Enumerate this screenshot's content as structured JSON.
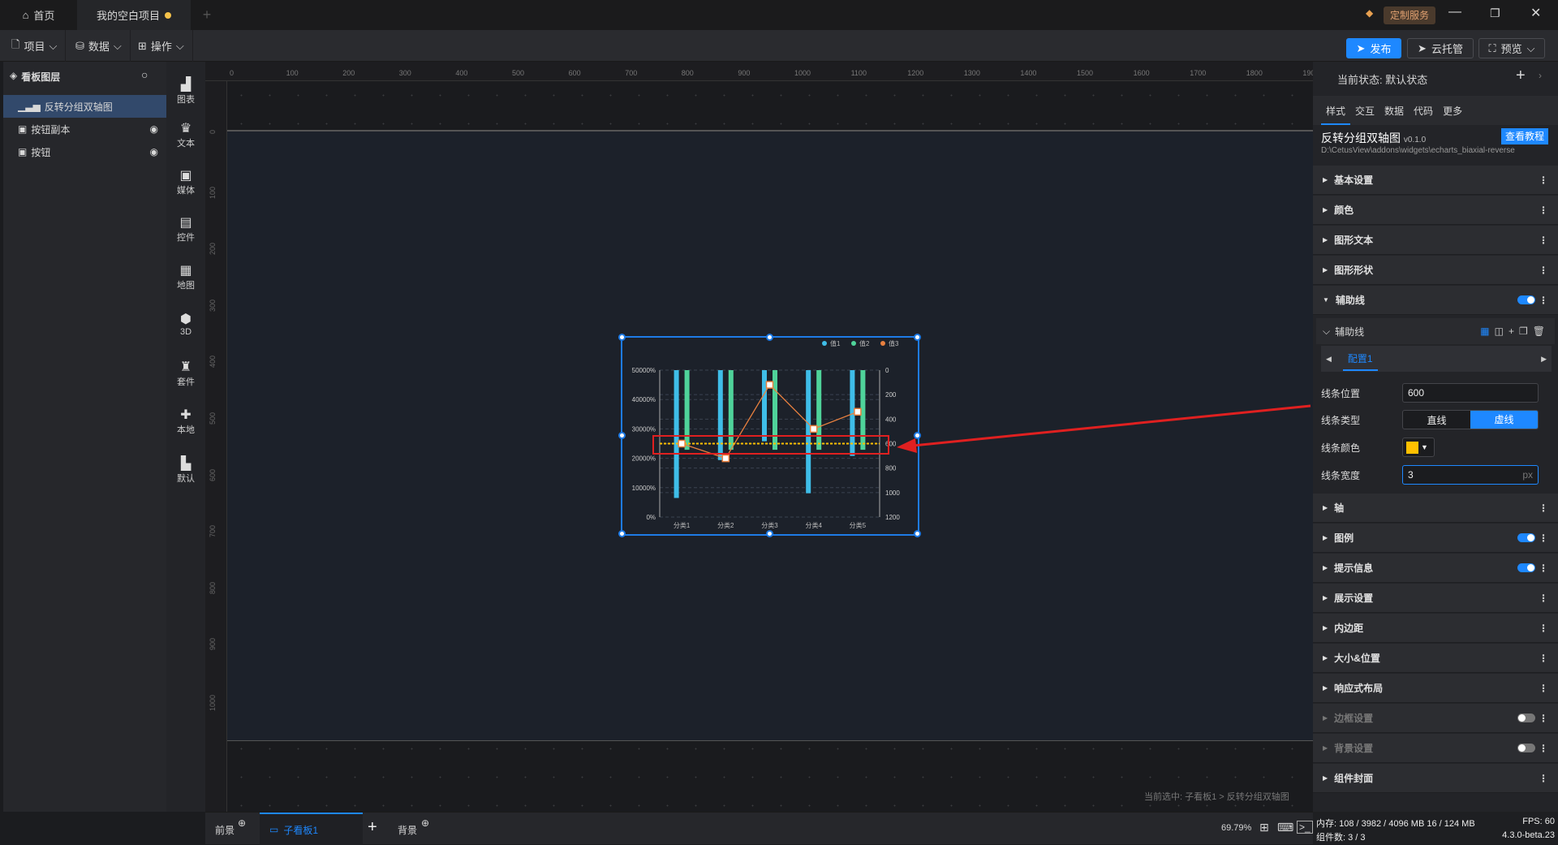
{
  "titlebar": {
    "home_tab": "首页",
    "project_tab": "我的空白项目",
    "custom_service": "定制服务"
  },
  "toolbar": {
    "project": "项目",
    "data": "数据",
    "operate": "操作",
    "publish": "发布",
    "cloud": "云托管",
    "preview": "预览"
  },
  "layers": {
    "title": "看板图层",
    "items": [
      {
        "label": "反转分组双轴图"
      },
      {
        "label": "按钮副本"
      },
      {
        "label": "按钮"
      }
    ]
  },
  "components": [
    {
      "label": "图表"
    },
    {
      "label": "文本"
    },
    {
      "label": "媒体"
    },
    {
      "label": "控件"
    },
    {
      "label": "地图"
    },
    {
      "label": "3D"
    },
    {
      "label": "套件"
    },
    {
      "label": "本地"
    },
    {
      "label": "默认"
    }
  ],
  "ruler": {
    "top": [
      "0",
      "100",
      "200",
      "300",
      "400",
      "500",
      "600",
      "700",
      "800",
      "900",
      "1000",
      "1100",
      "1200",
      "1300",
      "1400",
      "1500",
      "1600",
      "1700",
      "1800",
      "1900"
    ],
    "left": [
      "0",
      "100",
      "200",
      "300",
      "400",
      "500",
      "600",
      "700",
      "800",
      "900",
      "1000"
    ]
  },
  "breadcrumb": "当前选中: 子看板1 > 反转分组双轴图",
  "bottom_tabs": {
    "foreground": "前景",
    "subboard": "子看板1",
    "background": "背景"
  },
  "panel": {
    "state": "当前状态:  默认状态",
    "tabs": [
      "样式",
      "交互",
      "数据",
      "代码",
      "更多"
    ],
    "widget_name": "反转分组双轴图",
    "version": "v0.1.0",
    "tutorial": "查看教程",
    "path": "D:\\CetusView\\addons\\widgets\\echarts_biaxial-reverse",
    "sections_top": [
      "基本设置",
      "颜色",
      "图形文本",
      "图形形状",
      "辅助线"
    ],
    "sub_header": "辅助线",
    "config_tab": "配置1",
    "fields": {
      "position_label": "线条位置",
      "position_value": "600",
      "type_label": "线条类型",
      "type_solid": "直线",
      "type_dashed": "虚线",
      "color_label": "线条颜色",
      "color_value": "#ffc000",
      "width_label": "线条宽度",
      "width_value": "3",
      "width_unit": "px"
    },
    "sections_bottom": [
      {
        "label": "轴"
      },
      {
        "label": "图例",
        "toggle": true
      },
      {
        "label": "提示信息",
        "toggle": true
      },
      {
        "label": "展示设置"
      },
      {
        "label": "内边距"
      },
      {
        "label": "大小&位置"
      },
      {
        "label": "响应式布局"
      },
      {
        "label": "边框设置",
        "toggle": false
      },
      {
        "label": "背景设置",
        "toggle": false
      },
      {
        "label": "组件封面"
      }
    ]
  },
  "status": {
    "zoom": "69.79%",
    "memory": "内存: 108 / 3982 / 4096 MB  16 / 124 MB",
    "fps": "FPS:  60",
    "count": "组件数: 3 / 3",
    "version": "4.3.0-beta.23"
  },
  "chart_data": {
    "type": "bar",
    "categories": [
      "分类1",
      "分类2",
      "分类3",
      "分类4",
      "分类5"
    ],
    "legend": [
      "值1",
      "值2",
      "值3"
    ],
    "colors": [
      "#3fbde8",
      "#4fd39a",
      "#e8803f"
    ],
    "left_axis": {
      "ticks": [
        "0%",
        "10000%",
        "20000%",
        "30000%",
        "40000%",
        "50000%"
      ],
      "range": [
        0,
        50000
      ],
      "inverse_bars": true
    },
    "right_axis": {
      "ticks": [
        "0",
        "200",
        "400",
        "600",
        "800",
        "1000",
        "1200"
      ],
      "range": [
        0,
        1200
      ],
      "inverse": true
    },
    "series": [
      {
        "name": "值1",
        "type": "bar",
        "values": [
          43500,
          30600,
          24200,
          41900,
          29200
        ]
      },
      {
        "name": "值2",
        "type": "bar",
        "values": [
          27100,
          27100,
          27100,
          27100,
          27100
        ]
      },
      {
        "name": "值3",
        "type": "line",
        "values": [
          600,
          720,
          120,
          480,
          340
        ]
      }
    ],
    "mark_line": {
      "value": 600,
      "color": "#ffc000",
      "style": "dashed"
    }
  }
}
